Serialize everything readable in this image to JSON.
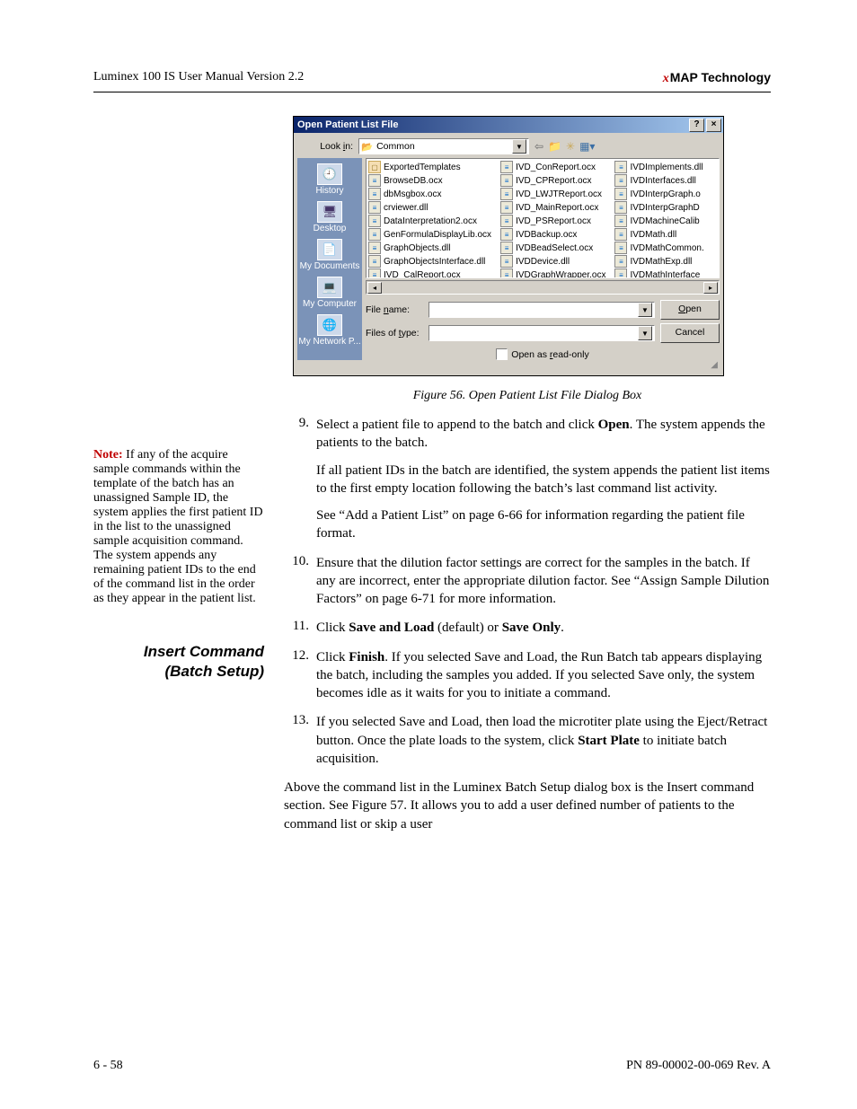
{
  "header": {
    "left": "Luminex 100 IS User Manual Version 2.2",
    "right_prefix": "x",
    "right": "MAP Technology"
  },
  "dialog": {
    "title": "Open Patient List File",
    "lookin_label": "Look in:",
    "lookin_value": "Common",
    "places": [
      "History",
      "Desktop",
      "My Documents",
      "My Computer",
      "My Network P..."
    ],
    "file_cols": [
      [
        "ExportedTemplates",
        "BrowseDB.ocx",
        "dbMsgbox.ocx",
        "crviewer.dll",
        "DataInterpretation2.ocx",
        "GenFormulaDisplayLib.ocx",
        "GraphObjects.dll",
        "GraphObjectsInterface.dll",
        "IVD_CalReport.ocx"
      ],
      [
        "IVD_ConReport.ocx",
        "IVD_CPReport.ocx",
        "IVD_LWJTReport.ocx",
        "IVD_MainReport.ocx",
        "IVD_PSReport.ocx",
        "IVDBackup.ocx",
        "IVDBeadSelect.ocx",
        "IVDDevice.dll",
        "IVDGraphWrapper.ocx"
      ],
      [
        "IVDImplements.dll",
        "IVDInterfaces.dll",
        "IVDInterpGraph.o",
        "IVDInterpGraphD",
        "IVDMachineCalib",
        "IVDMath.dll",
        "IVDMathCommon.",
        "IVDMathExp.dll",
        "IVDMathInterface"
      ]
    ],
    "filename_label": "File name:",
    "filetype_label": "Files of type:",
    "open_btn": "Open",
    "cancel_btn": "Cancel",
    "readonly_label": "Open as read-only"
  },
  "caption": "Figure 56.  Open Patient List File Dialog Box",
  "note_label": "Note:",
  "note_body": "  If any of the acquire sample commands within the template of the batch has an unassigned Sample ID, the system applies the first patient ID in the list to the unassigned sample acquisition command. The system appends any remaining patient IDs to the end of the command list in the order as they appear in the patient list.",
  "steps": [
    {
      "num": "9.",
      "paras": [
        {
          "pre": "Select a patient file to append to the batch and click ",
          "b": "Open",
          "post": ". The system appends the patients to the batch."
        },
        {
          "plain": "If all patient IDs in the batch are identified, the system appends the patient list items to the first empty location following the batch’s last command list activity."
        },
        {
          "plain": "See “Add a Patient List” on page 6-66 for information regarding the patient file format."
        }
      ]
    },
    {
      "num": "10.",
      "paras": [
        {
          "plain": "Ensure that the dilution factor settings are correct for the samples in the batch. If any are incorrect, enter the appropriate dilution factor. See “Assign Sample Dilution Factors” on page 6-71 for more information."
        }
      ]
    },
    {
      "num": "11.",
      "paras": [
        {
          "pre": "Click ",
          "b": "Save and Load",
          "mid": " (default) or ",
          "b2": "Save Only",
          "post": "."
        }
      ]
    },
    {
      "num": "12.",
      "paras": [
        {
          "pre": "Click ",
          "b": "Finish",
          "post": ". If you selected Save and Load, the Run Batch tab appears displaying the batch, including the samples you added. If you selected Save only, the system becomes idle as it waits for you to initiate a command."
        }
      ]
    },
    {
      "num": "13.",
      "paras": [
        {
          "pre": "If you selected Save and Load, then load the microtiter plate using the Eject/Retract button. Once the plate loads to the system, click ",
          "b": "Start Plate",
          "post": " to initiate batch acquisition."
        }
      ]
    }
  ],
  "section_heading_l1": "Insert Command",
  "section_heading_l2": "(Batch Setup)",
  "insert_para": "Above the command list in the Luminex Batch Setup dialog box is the Insert command section. See Figure 57. It allows you to add a user defined number of patients to the command list or skip a user",
  "footer": {
    "left": "6 - 58",
    "right": "PN 89-00002-00-069 Rev. A"
  }
}
